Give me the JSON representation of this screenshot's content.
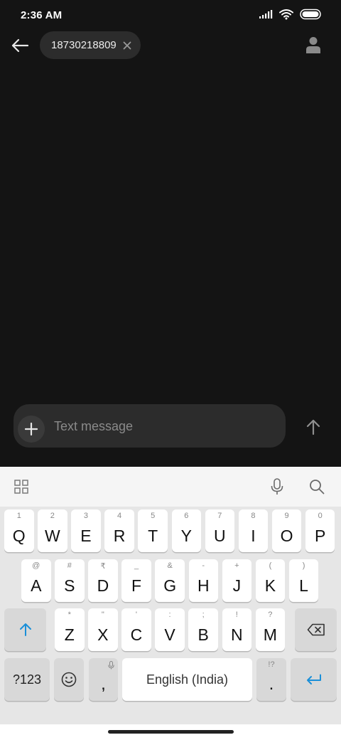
{
  "status_bar": {
    "time": "2:36 AM"
  },
  "header": {
    "recipient": "18730218809"
  },
  "composer": {
    "placeholder": "Text message"
  },
  "keyboard": {
    "row1": [
      {
        "hint": "1",
        "key": "Q"
      },
      {
        "hint": "2",
        "key": "W"
      },
      {
        "hint": "3",
        "key": "E"
      },
      {
        "hint": "4",
        "key": "R"
      },
      {
        "hint": "5",
        "key": "T"
      },
      {
        "hint": "6",
        "key": "Y"
      },
      {
        "hint": "7",
        "key": "U"
      },
      {
        "hint": "8",
        "key": "I"
      },
      {
        "hint": "9",
        "key": "O"
      },
      {
        "hint": "0",
        "key": "P"
      }
    ],
    "row2": [
      {
        "hint": "@",
        "key": "A"
      },
      {
        "hint": "#",
        "key": "S"
      },
      {
        "hint": "₹",
        "key": "D"
      },
      {
        "hint": "_",
        "key": "F"
      },
      {
        "hint": "&",
        "key": "G"
      },
      {
        "hint": "-",
        "key": "H"
      },
      {
        "hint": "+",
        "key": "J"
      },
      {
        "hint": "(",
        "key": "K"
      },
      {
        "hint": ")",
        "key": "L"
      }
    ],
    "row3": [
      {
        "hint": "*",
        "key": "Z"
      },
      {
        "hint": "\"",
        "key": "X"
      },
      {
        "hint": "'",
        "key": "C"
      },
      {
        "hint": ":",
        "key": "V"
      },
      {
        "hint": ";",
        "key": "B"
      },
      {
        "hint": "!",
        "key": "N"
      },
      {
        "hint": "?",
        "key": "M"
      }
    ],
    "symbols_label": "?123",
    "comma": ",",
    "space_label": "English (India)",
    "period_hint": "!?",
    "period": "."
  },
  "colors": {
    "accent_blue": "#1a8fd8",
    "background": "#141414"
  }
}
